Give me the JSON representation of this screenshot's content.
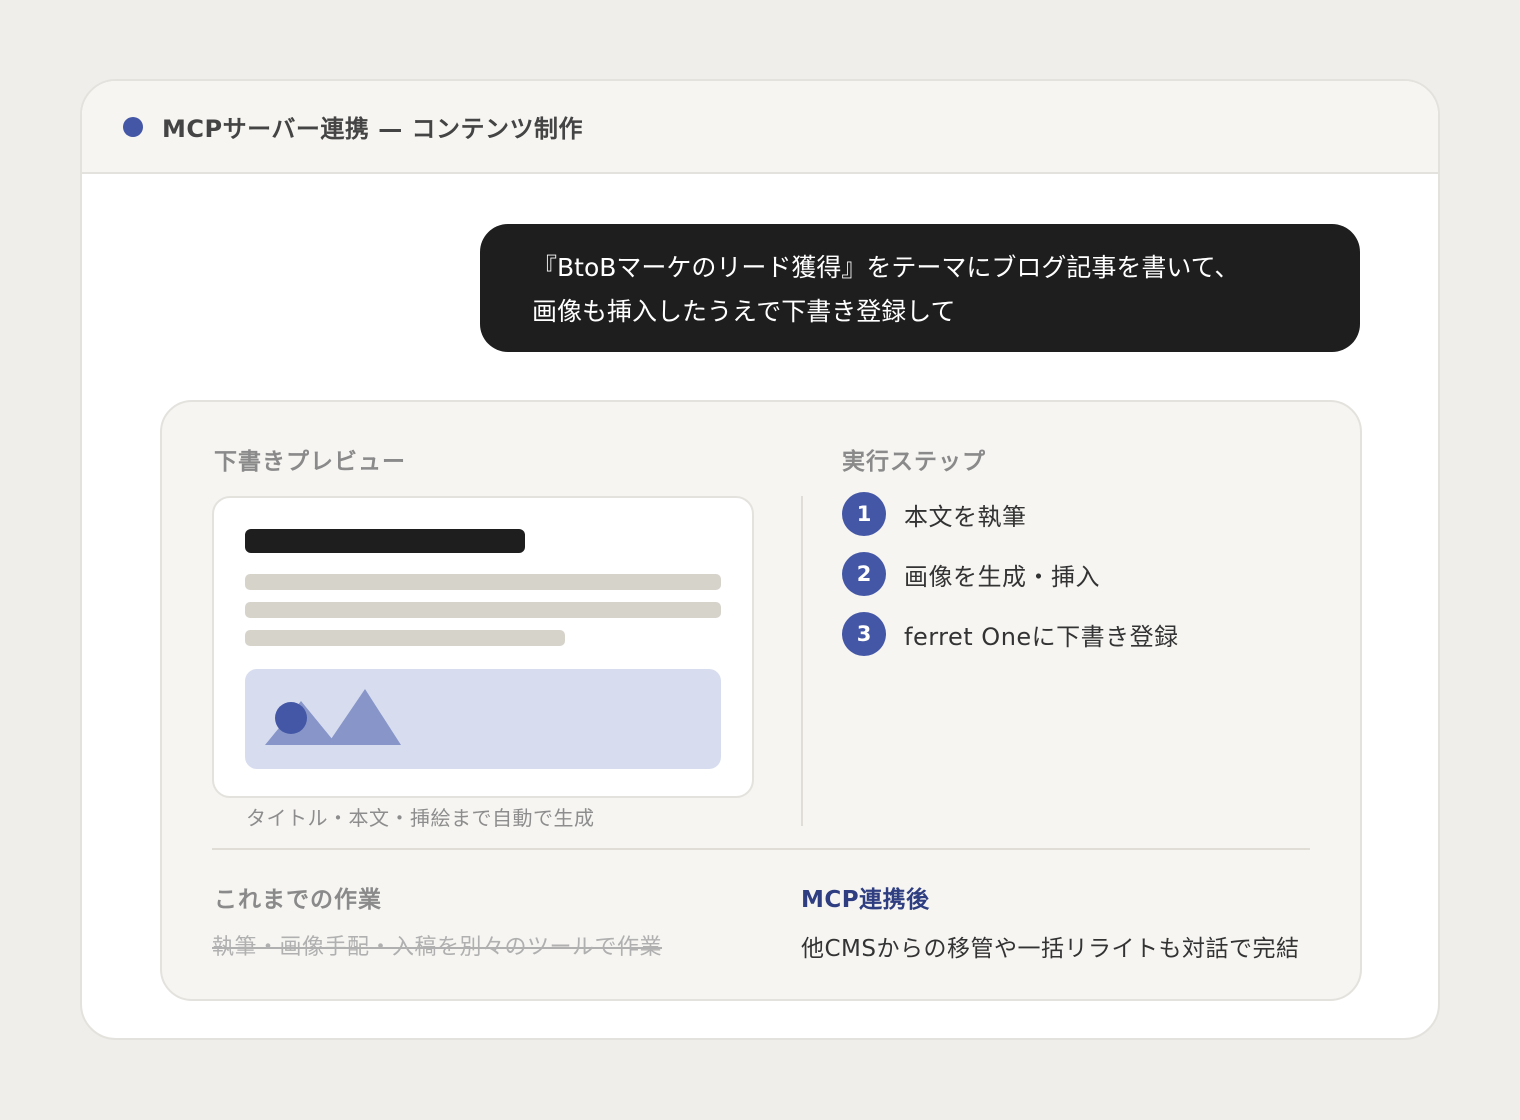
{
  "window": {
    "title": "MCPサーバー連携 — コンテンツ制作",
    "accent_color": "#4457a6"
  },
  "prompt": {
    "line1": "『BtoBマーケのリード獲得』をテーマにブログ記事を書いて、",
    "line2": "画像も挿入したうえで下書き登録して"
  },
  "preview": {
    "label": "下書きプレビュー",
    "caption": "タイトル・本文・挿絵まで自動で生成",
    "image_icon": "landscape-image-icon"
  },
  "steps": {
    "label": "実行ステップ",
    "items": [
      {
        "number": "1",
        "label": "本文を執筆"
      },
      {
        "number": "2",
        "label": "画像を生成・挿入"
      },
      {
        "number": "3",
        "label": "ferret Oneに下書き登録"
      }
    ]
  },
  "comparison": {
    "before_label": "これまでの作業",
    "before_text": "執筆・画像手配・入稿を別々のツールで作業",
    "after_label": "MCP連携後",
    "after_text": "他CMSからの移管や一括リライトも対話で完結"
  }
}
